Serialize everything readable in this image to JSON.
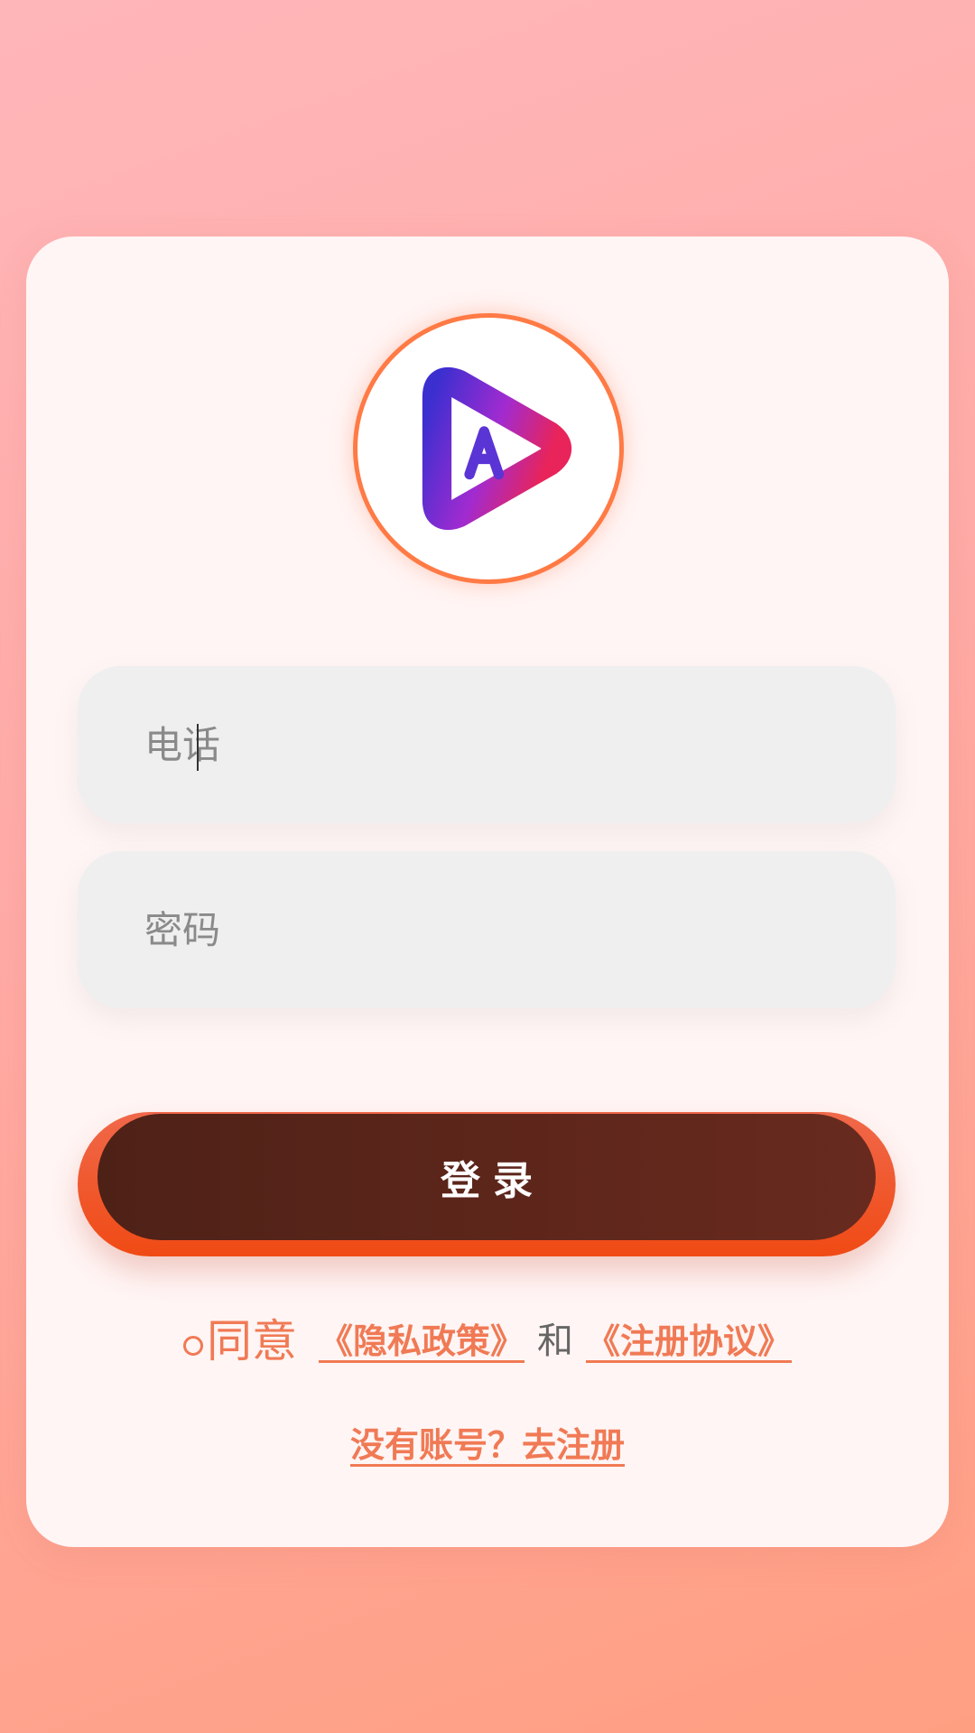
{
  "logo": {
    "icon": "play-triangle-logo-icon",
    "ring_color": "#ff7a45",
    "gradient": [
      "#3b2fd0",
      "#a12bd0",
      "#e8245a"
    ]
  },
  "form": {
    "phone_placeholder": "电话",
    "phone_value": "",
    "password_placeholder": "密码",
    "password_value": ""
  },
  "login_button": {
    "label": "登录"
  },
  "agreement": {
    "agree_label": "同意",
    "privacy_link": "《隐私政策》",
    "and_text": "和",
    "register_agreement_link": "《注册协议》"
  },
  "register_link": "没有账号？去注册",
  "colors": {
    "accent": "#f07a55",
    "button_dark": "#5e261b",
    "button_rim": "#f04a14",
    "card_bg": "#fff5f4"
  }
}
